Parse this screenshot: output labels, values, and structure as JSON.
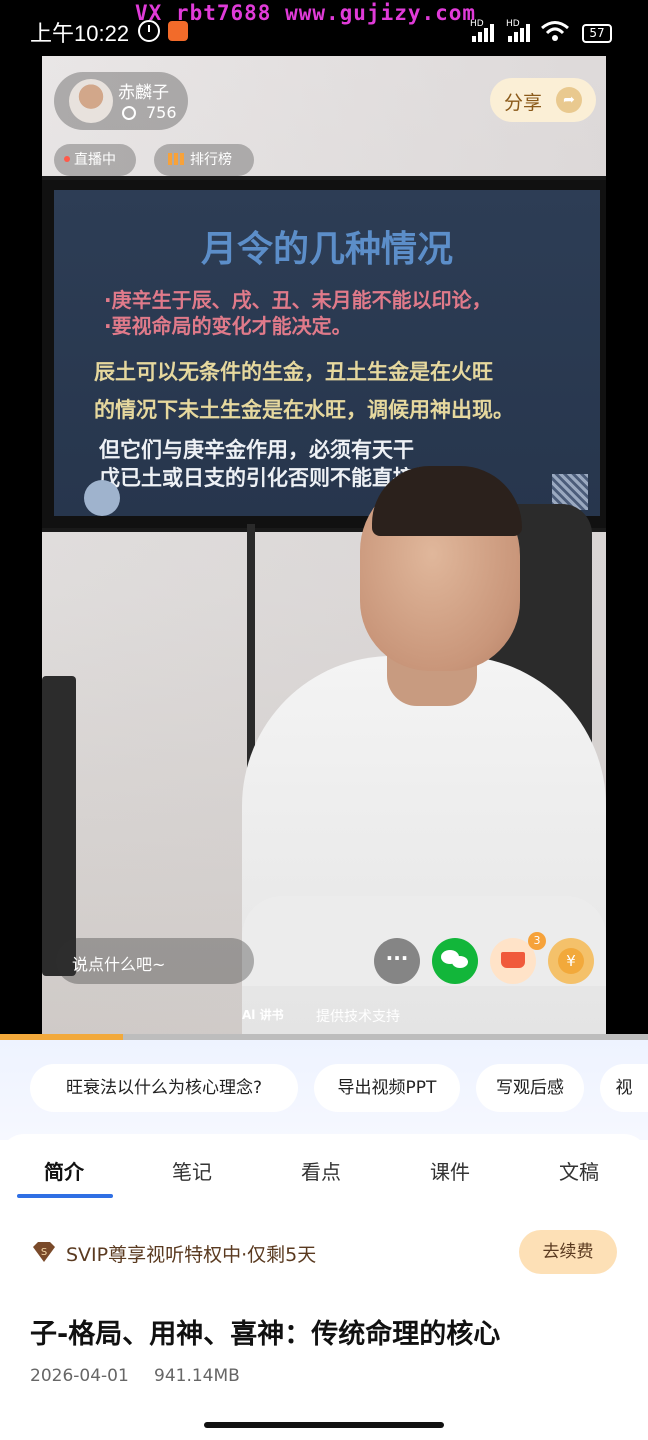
{
  "status_bar": {
    "time": "上午10:22",
    "watermark": "VX rbt7688  www.gujizy.com",
    "hd1": "HD",
    "hd2": "HD",
    "battery": "57"
  },
  "live": {
    "streamer_name": "赤麟子",
    "viewer_count": "756",
    "share_label": "分享",
    "share_icon": "arrow-share-icon",
    "tag_live": "直播中",
    "tag_rank": "排行榜",
    "slide": {
      "title": "月令的几种情况",
      "red_line1": "·庚辛生于辰、戌、丑、未月能不能以印论，",
      "red_line2": "·要视命局的变化才能决定。",
      "yellow_line1": "辰土可以无条件的生金，丑土生金是在火旺",
      "yellow_line2": "的情况下未土生金是在水旺，调候用神出现。",
      "white_line1": "但它们与庚辛金作用，必须有天干",
      "white_line2": "戊已土或日支的引化否则不能直接生扶。"
    },
    "comment_placeholder": "说点什么吧~",
    "more_label": "···",
    "cart_badge": "3",
    "coin_symbol": "¥",
    "tech_logo": "Al 讲书",
    "tech_support": "提供技术支持",
    "progress": 0.19
  },
  "quick_chips": [
    "旺衰法以什么为核心理念?",
    "导出视频PPT",
    "写观后感",
    "视"
  ],
  "tabs": [
    "简介",
    "笔记",
    "看点",
    "课件",
    "文稿"
  ],
  "svip": {
    "badge": "S",
    "text": "SVIP尊享视听特权中·仅剩5天",
    "renew": "去续费"
  },
  "video": {
    "title": "子-格局、用神、喜神：传统命理的核心",
    "date": "2026-04-01",
    "size": "941.14MB"
  },
  "colors": {
    "accent_blue": "#2f6fe4",
    "progress": "#f2a93b",
    "renew_bg": "#fde0b6",
    "wechat_green": "#12b63a"
  }
}
